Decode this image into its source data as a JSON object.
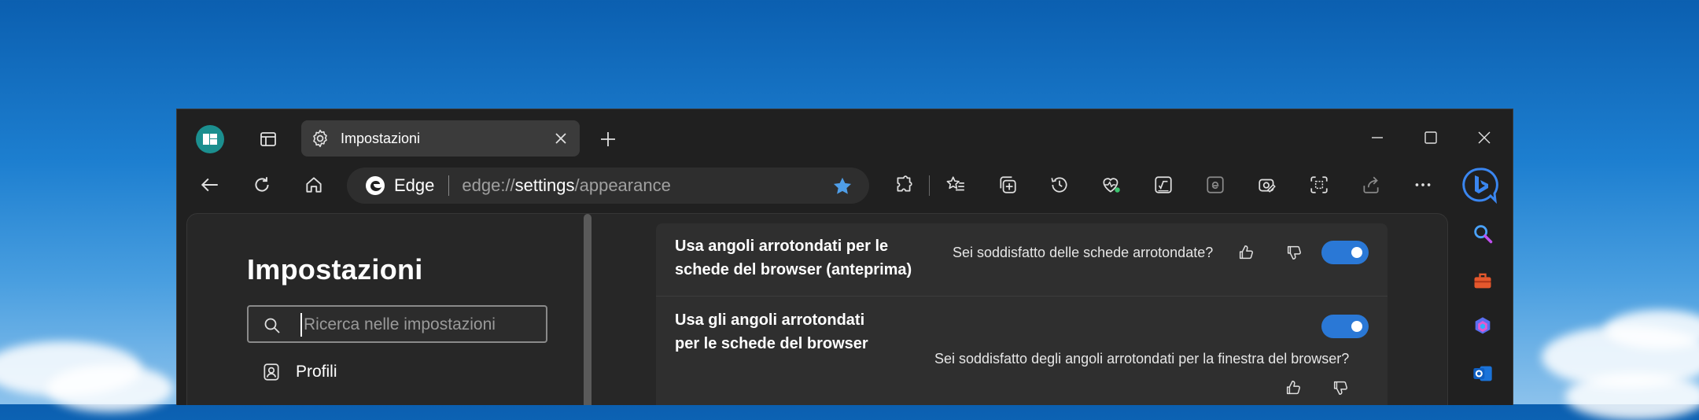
{
  "window": {
    "tab_title": "Impostazioni"
  },
  "address_bar": {
    "site_name": "Edge",
    "url_prefix": "edge://",
    "url_highlight": "settings",
    "url_suffix": "/appearance"
  },
  "settings_nav": {
    "title": "Impostazioni",
    "search_placeholder": "Ricerca nelle impostazioni",
    "items": [
      {
        "label": "Profili",
        "icon": "profiles-icon"
      }
    ]
  },
  "settings_rows": [
    {
      "title_line1": "Usa angoli arrotondati per le",
      "title_line2": "schede del browser (anteprima)",
      "feedback_question": "Sei soddisfatto delle schede arrotondate?",
      "enabled": true
    },
    {
      "title_line1": "Usa gli angoli arrotondati",
      "title_line2": "per le schede del browser",
      "feedback_question": "Sei soddisfatto degli angoli arrotondati per la finestra del browser?",
      "enabled": true
    }
  ],
  "colors": {
    "accent": "#2a78d6",
    "window_bg": "#202020",
    "panel_bg": "#272727",
    "card_bg": "#2f2f2f"
  }
}
